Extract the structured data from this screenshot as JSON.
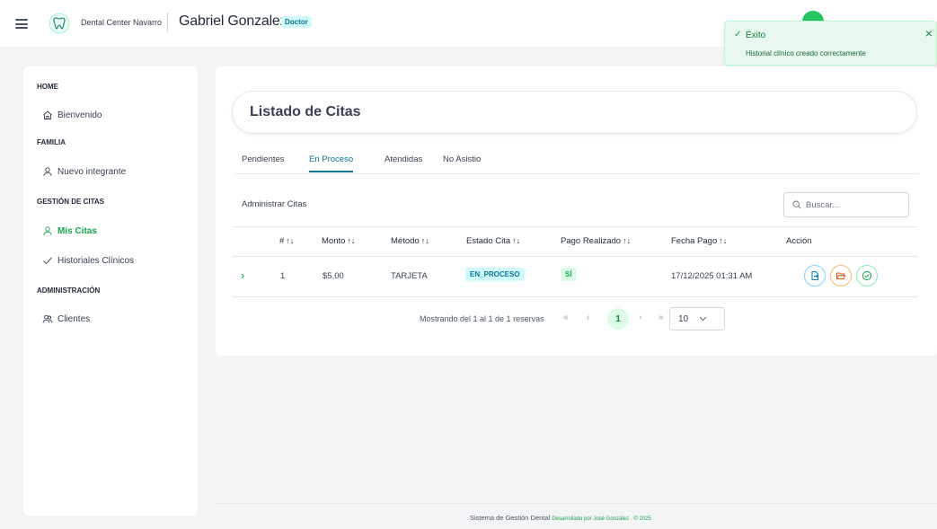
{
  "header": {
    "clinic_name": "Dental Center Navarro",
    "user_name": "Gabriel Gonzalez",
    "role": "Doctor"
  },
  "toast": {
    "title": "Éxito",
    "message": "Historial clínico creado correctamente",
    "close": "×"
  },
  "sidebar": {
    "sections": [
      {
        "label": "HOME",
        "items": [
          {
            "label": "Bienvenido",
            "icon": "home-icon"
          }
        ]
      },
      {
        "label": "FAMILIA",
        "items": [
          {
            "label": "Nuevo integrante",
            "icon": "user-icon"
          }
        ]
      },
      {
        "label": "GESTIÓN DE CITAS",
        "items": [
          {
            "label": "Mis Citas",
            "icon": "user-icon",
            "active": true
          },
          {
            "label": "Historiales Clínicos",
            "icon": "check-icon"
          }
        ]
      },
      {
        "label": "ADMINISTRACIÓN",
        "items": [
          {
            "label": "Clientes",
            "icon": "users-icon"
          }
        ]
      }
    ]
  },
  "main": {
    "title": "Listado de Citas",
    "tabs": [
      "Pendientes",
      "En Proceso",
      "Atendidas",
      "No Asistio"
    ],
    "active_tab": "En Proceso",
    "admin_label": "Administrar Citas",
    "search_placeholder": "Buscar...",
    "table": {
      "columns": [
        "#",
        "Monto",
        "Método",
        "Estado Cita",
        "Pago Realizado",
        "Fecha Pago",
        "Acción"
      ],
      "sort_glyph": "↑↓",
      "rows": [
        {
          "num": "1",
          "monto": "$5.00",
          "metodo": "TARJETA",
          "estado": "EN_PROCESO",
          "pago": "SÍ",
          "fecha": "17/12/2025 01:31 AM"
        }
      ]
    },
    "pagination": {
      "info": "Mostrando del 1 al 1 de 1 reservas",
      "first": "«",
      "prev": "‹",
      "current": "1",
      "next": "›",
      "last": "»",
      "rows_per_page": "10"
    }
  },
  "footer": {
    "text": "Sistema de Gestión Dental",
    "brand": "Desarrollado por José González · © 2025"
  },
  "colors": {
    "accent_green": "#16a34a",
    "accent_cyan": "#0e7490"
  }
}
